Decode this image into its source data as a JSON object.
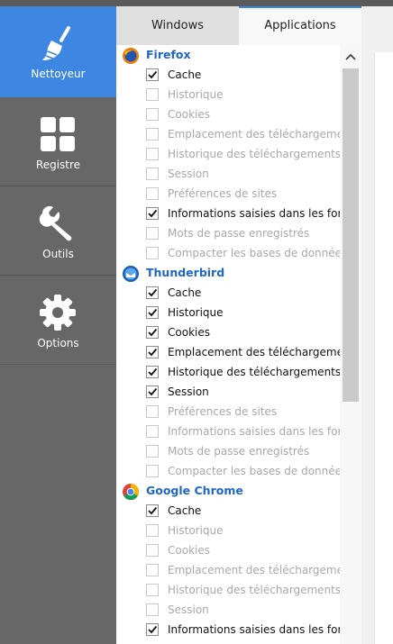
{
  "sidebar": {
    "items": [
      {
        "label": "Nettoyeur",
        "icon": "broom-icon",
        "active": true
      },
      {
        "label": "Registre",
        "icon": "grid-icon",
        "active": false
      },
      {
        "label": "Outils",
        "icon": "wrench-icon",
        "active": false
      },
      {
        "label": "Options",
        "icon": "gear-icon",
        "active": false
      }
    ]
  },
  "tabs": [
    {
      "label": "Windows",
      "selected": false
    },
    {
      "label": "Applications",
      "selected": true
    }
  ],
  "groups": [
    {
      "name": "Firefox",
      "icon": "firefox-icon",
      "items": [
        {
          "label": "Cache",
          "checked": true
        },
        {
          "label": "Historique",
          "checked": false
        },
        {
          "label": "Cookies",
          "checked": false
        },
        {
          "label": "Emplacement des téléchargements",
          "checked": false
        },
        {
          "label": "Historique des téléchargements",
          "checked": false
        },
        {
          "label": "Session",
          "checked": false
        },
        {
          "label": "Préférences de sites",
          "checked": false
        },
        {
          "label": "Informations saisies dans les formulaires",
          "checked": true
        },
        {
          "label": "Mots de passe enregistrés",
          "checked": false
        },
        {
          "label": "Compacter les bases de données",
          "checked": false
        }
      ]
    },
    {
      "name": "Thunderbird",
      "icon": "thunderbird-icon",
      "items": [
        {
          "label": "Cache",
          "checked": true
        },
        {
          "label": "Historique",
          "checked": true
        },
        {
          "label": "Cookies",
          "checked": true
        },
        {
          "label": "Emplacement des téléchargements",
          "checked": true
        },
        {
          "label": "Historique des téléchargements",
          "checked": true
        },
        {
          "label": "Session",
          "checked": true
        },
        {
          "label": "Préférences de sites",
          "checked": false
        },
        {
          "label": "Informations saisies dans les formulaires",
          "checked": false
        },
        {
          "label": "Mots de passe enregistrés",
          "checked": false
        },
        {
          "label": "Compacter les bases de données",
          "checked": false
        }
      ]
    },
    {
      "name": "Google Chrome",
      "icon": "chrome-icon",
      "items": [
        {
          "label": "Cache",
          "checked": true
        },
        {
          "label": "Historique",
          "checked": false
        },
        {
          "label": "Cookies",
          "checked": false
        },
        {
          "label": "Emplacement des téléchargements",
          "checked": false
        },
        {
          "label": "Historique des téléchargements",
          "checked": false
        },
        {
          "label": "Session",
          "checked": false
        },
        {
          "label": "Informations saisies dans les formulaires",
          "checked": true
        }
      ]
    }
  ],
  "colors": {
    "accent": "#3d87e3",
    "sidebar": "#676767",
    "app_name": "#1f66c5"
  }
}
